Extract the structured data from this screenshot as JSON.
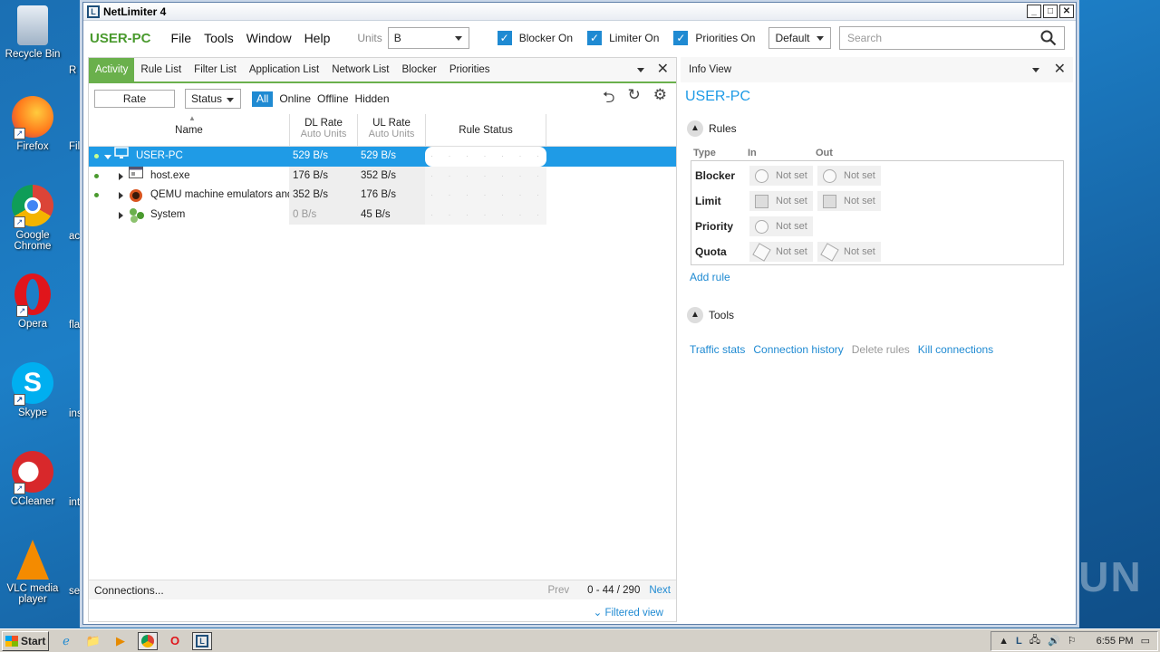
{
  "desktop": {
    "icons": [
      {
        "label": "Recycle Bin"
      },
      {
        "label": "Firefox"
      },
      {
        "label": "Google Chrome"
      },
      {
        "label": "Opera"
      },
      {
        "label": "Skype"
      },
      {
        "label": "CCleaner"
      },
      {
        "label": "VLC media player"
      }
    ],
    "partial_labels": [
      "R",
      "Fil",
      "ac",
      "fla",
      "ins",
      "int",
      "se"
    ]
  },
  "window": {
    "title": "NetLimiter 4",
    "brand": "USER-PC",
    "menu": [
      "File",
      "Tools",
      "Window",
      "Help"
    ],
    "units_label": "Units",
    "units_value": "B",
    "checks": [
      {
        "label": "Blocker On",
        "checked": true
      },
      {
        "label": "Limiter On",
        "checked": true
      },
      {
        "label": "Priorities On",
        "checked": true
      }
    ],
    "profile_value": "Default",
    "search_placeholder": "Search"
  },
  "left_pane": {
    "tabs": [
      "Activity",
      "Rule List",
      "Filter List",
      "Application List",
      "Network List",
      "Blocker",
      "Priorities"
    ],
    "active_tab": "Activity",
    "rate_label": "Rate",
    "status_label": "Status",
    "filters": [
      "All",
      "Online",
      "Offline",
      "Hidden"
    ],
    "columns": {
      "name": "Name",
      "dl": "DL Rate",
      "dl_sub": "Auto Units",
      "ul": "UL Rate",
      "ul_sub": "Auto Units",
      "rule": "Rule Status"
    },
    "rows": [
      {
        "name": "USER-PC",
        "dl": "529 B/s",
        "ul": "529 B/s",
        "online": true
      },
      {
        "name": "host.exe",
        "dl": "176 B/s",
        "ul": "352 B/s",
        "online": true
      },
      {
        "name": "QEMU machine emulators and",
        "dl": "352 B/s",
        "ul": "176 B/s",
        "online": true
      },
      {
        "name": "System",
        "dl": "0 B/s",
        "ul": "45 B/s",
        "online": false
      }
    ],
    "rule_dots": "· · · · · · ·",
    "footer": {
      "connections": "Connections...",
      "prev": "Prev",
      "range": "0 - 44 / 290",
      "next": "Next",
      "filtered": "Filtered view"
    }
  },
  "info_view": {
    "header": "Info View",
    "title": "USER-PC",
    "rules_section": "Rules",
    "col_type": "Type",
    "col_in": "In",
    "col_out": "Out",
    "rules": [
      {
        "type": "Blocker",
        "in": "Not set",
        "out": "Not set"
      },
      {
        "type": "Limit",
        "in": "Not set",
        "out": "Not set"
      },
      {
        "type": "Priority",
        "in": "Not set",
        "out": ""
      },
      {
        "type": "Quota",
        "in": "Not set",
        "out": "Not set"
      }
    ],
    "add_rule": "Add rule",
    "tools_section": "Tools",
    "tools": [
      "Traffic stats",
      "Connection history",
      "Delete rules",
      "Kill connections"
    ]
  },
  "taskbar": {
    "start": "Start",
    "clock": "6:55 PM"
  },
  "watermark": "ANY RUN",
  "colors": {
    "accent_green": "#6ab04c",
    "accent_blue": "#1f9be6",
    "selection": "#1f9be6"
  }
}
